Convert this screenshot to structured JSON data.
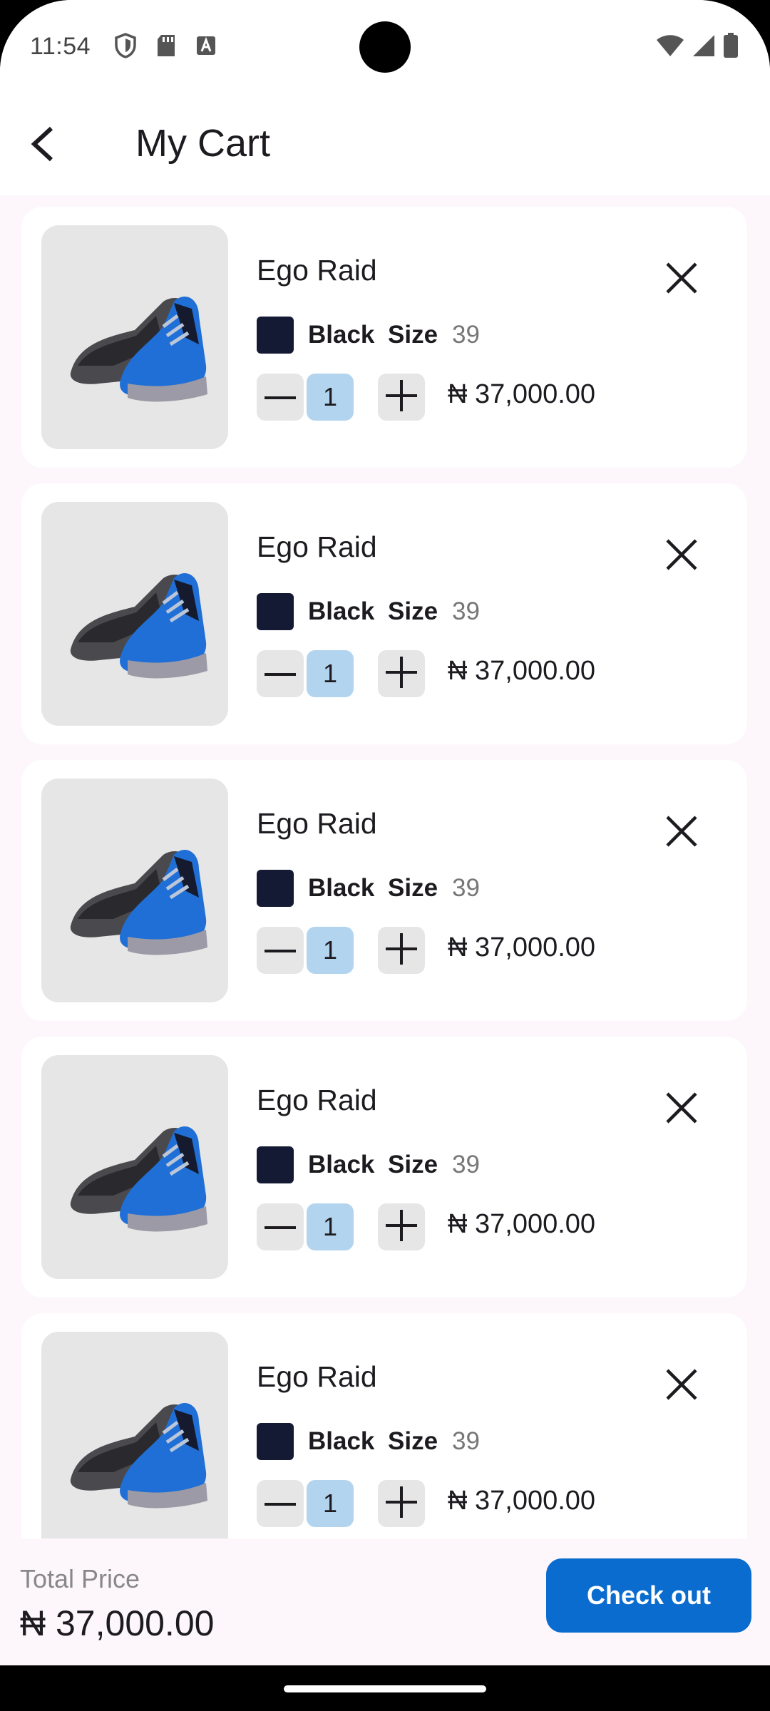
{
  "status_bar": {
    "time": "11:54",
    "left_icons": [
      "shield-icon",
      "sd-card-icon",
      "keyboard-a-icon"
    ],
    "right_icons": [
      "wifi-icon",
      "signal-icon",
      "battery-icon"
    ]
  },
  "app_bar": {
    "title": "My Cart",
    "back_icon": "chevron-left-icon"
  },
  "cart": {
    "items": [
      {
        "name": "Ego Raid",
        "color_name": "Black",
        "color_hex": "#141a33",
        "size_label": "Size",
        "size": "39",
        "quantity": "1",
        "price": "₦ 37,000.00"
      },
      {
        "name": "Ego Raid",
        "color_name": "Black",
        "color_hex": "#141a33",
        "size_label": "Size",
        "size": "39",
        "quantity": "1",
        "price": "₦ 37,000.00"
      },
      {
        "name": "Ego Raid",
        "color_name": "Black",
        "color_hex": "#141a33",
        "size_label": "Size",
        "size": "39",
        "quantity": "1",
        "price": "₦ 37,000.00"
      },
      {
        "name": "Ego Raid",
        "color_name": "Black",
        "color_hex": "#141a33",
        "size_label": "Size",
        "size": "39",
        "quantity": "1",
        "price": "₦ 37,000.00"
      },
      {
        "name": "Ego Raid",
        "color_name": "Black",
        "color_hex": "#141a33",
        "size_label": "Size",
        "size": "39",
        "quantity": "1",
        "price": "₦ 37,000.00"
      }
    ]
  },
  "footer": {
    "total_label": "Total Price",
    "total_value": "₦ 37,000.00",
    "checkout_label": "Check out"
  },
  "colors": {
    "accent": "#0a6ccf",
    "quantity_highlight": "#b3d4ee",
    "background": "#fdf7fc"
  }
}
